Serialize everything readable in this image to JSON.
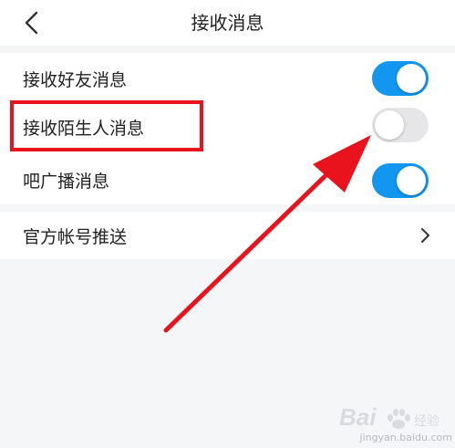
{
  "header": {
    "title": "接收消息",
    "back_icon": "chevron-left-icon"
  },
  "settings": [
    {
      "label": "接收好友消息",
      "control": "toggle",
      "on": true
    },
    {
      "label": "接收陌生人消息",
      "control": "toggle",
      "on": false
    },
    {
      "label": "吧广播消息",
      "control": "toggle",
      "on": true
    },
    {
      "label": "官方帐号推送",
      "control": "chevron",
      "icon": "chevron-right-icon"
    }
  ],
  "annotation": {
    "highlight_color": "#e8131c",
    "arrow_color": "#e8131c"
  },
  "watermark": {
    "text": "jingyan.baidu.com"
  },
  "colors": {
    "toggle_on": "#1296f0",
    "toggle_off": "#e6e6e8",
    "background": "#f5f6f8"
  }
}
